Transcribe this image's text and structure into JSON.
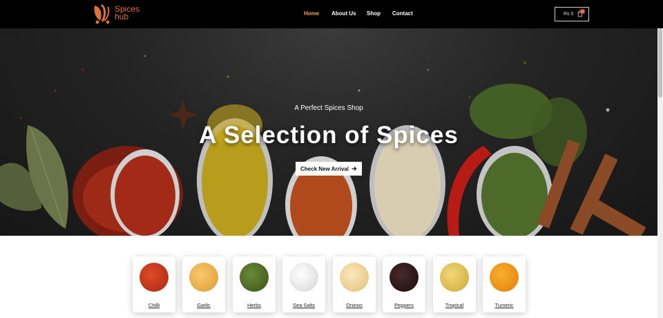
{
  "header": {
    "logo_text_line1": "Spices",
    "logo_text_line2": "hub",
    "nav": [
      {
        "label": "Home",
        "active": true
      },
      {
        "label": "About Us",
        "active": false
      },
      {
        "label": "Shop",
        "active": false
      },
      {
        "label": "Contact",
        "active": false
      }
    ],
    "cart": {
      "amount": "Rs 0",
      "count": "0"
    }
  },
  "hero": {
    "subtitle": "A Perfect Spices Shop",
    "title": "A Selection of Spices",
    "button_label": "Check New Arrival",
    "button_icon": "arrow-right-icon"
  },
  "categories": [
    {
      "label": "Chilli",
      "color": "#c8381c"
    },
    {
      "label": "Garlic",
      "color": "#f0b04c"
    },
    {
      "label": "Herbs",
      "color": "#4e6b28"
    },
    {
      "label": "Sea Salts",
      "color": "#ececec"
    },
    {
      "label": "Oninos",
      "color": "#f1d8a0"
    },
    {
      "label": "Peppers",
      "color": "#2a1616"
    },
    {
      "label": "Tropical",
      "color": "#e4c25a"
    },
    {
      "label": "Tumeric",
      "color": "#f09a18"
    }
  ],
  "colors": {
    "accent": "#f0a044",
    "brand": "#e0703c",
    "header_bg": "#000000"
  }
}
